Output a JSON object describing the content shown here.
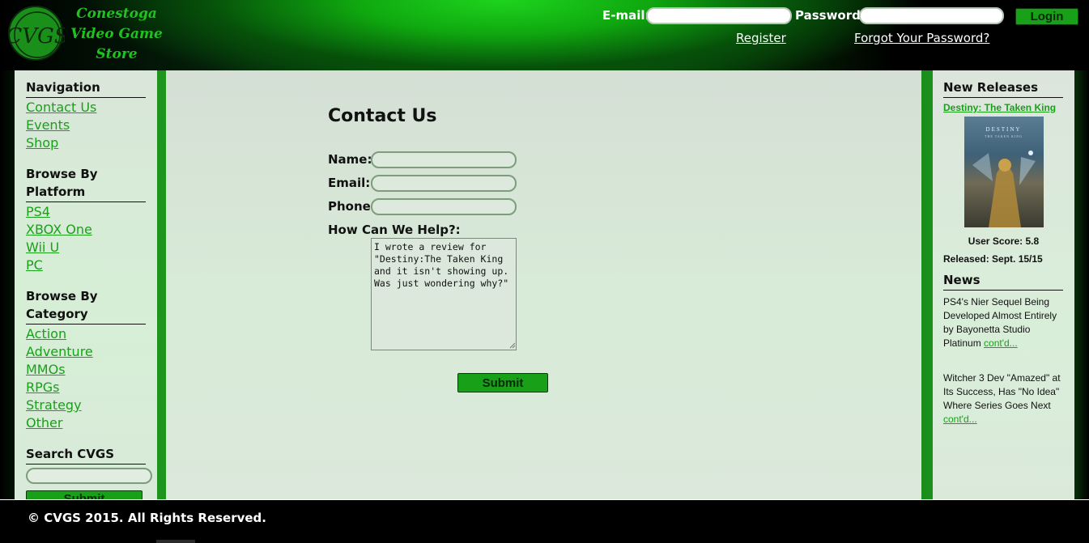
{
  "brand": {
    "logo_initials": "CVGS",
    "name_lines": [
      "Conestoga",
      "Video Game",
      "Store"
    ]
  },
  "login": {
    "email_label": "E-mail:",
    "password_label": "Password:",
    "email_value": "",
    "password_value": "",
    "login_button": "Login",
    "register_link": "Register",
    "forgot_link": "Forgot Your Password?"
  },
  "sidebar": {
    "navigation": {
      "heading": "Navigation",
      "items": [
        "Contact Us",
        "Events",
        "Shop"
      ]
    },
    "platform": {
      "heading": "Browse By Platform",
      "items": [
        "PS4",
        "XBOX One",
        "Wii U",
        "PC"
      ]
    },
    "category": {
      "heading": "Browse By Category",
      "items": [
        "Action",
        "Adventure",
        "MMOs",
        "RPGs",
        "Strategy",
        "Other"
      ]
    },
    "search": {
      "heading": "Search CVGS",
      "value": "",
      "submit_label": "Submit"
    }
  },
  "main": {
    "title": "Contact Us",
    "name_label": "Name:",
    "email_label": "Email:",
    "phone_label": "Phone:",
    "help_label": "How Can We Help?:",
    "name_value": "",
    "email_value": "",
    "phone_value": "",
    "help_value": "I wrote a review for \"Destiny:The Taken King and it isn't showing up.  Was just wondering why?\"",
    "submit_label": "Submit"
  },
  "right": {
    "releases_heading": "New Releases",
    "release_title": "Destiny: The Taken King",
    "cover_title": "DESTINY",
    "cover_subtitle": "THE TAKEN KING",
    "user_score": "User Score: 5.8",
    "released": "Released: Sept. 15/15",
    "news_heading": "News",
    "news": [
      {
        "text": "PS4's Nier Sequel Being Developed Almost Entirely by Bayonetta Studio Platinum ",
        "link": "cont'd..."
      },
      {
        "text": "Witcher 3 Dev \"Amazed\" at Its Success, Has \"No Idea\" Where Series Goes Next ",
        "link": "cont'd..."
      }
    ]
  },
  "footer": {
    "copyright": "© CVGS 2015. All Rights Reserved."
  },
  "colors": {
    "accent_green": "#1aa01a",
    "button_green": "#19a019",
    "panel_bg": "#d8ebd8"
  }
}
